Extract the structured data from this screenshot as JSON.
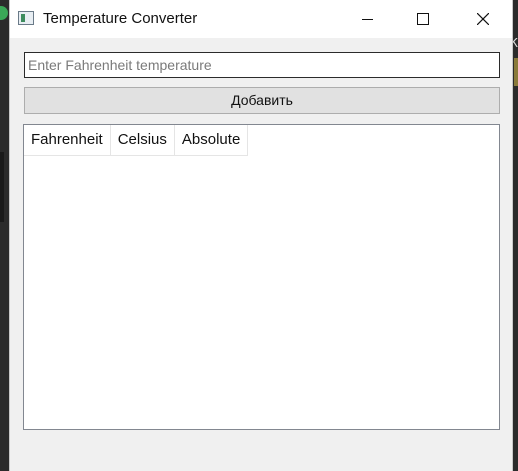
{
  "window": {
    "title": "Temperature Converter"
  },
  "form": {
    "input_placeholder": "Enter Fahrenheit temperature",
    "input_value": "",
    "add_button_label": "Добавить"
  },
  "table": {
    "columns": [
      "Fahrenheit",
      "Celsius",
      "Absolute"
    ],
    "rows": []
  },
  "background": {
    "right_edge_text": "К"
  },
  "colors": {
    "window_bg": "#f0f0f0",
    "titlebar_bg": "#ffffff",
    "button_bg": "#e1e1e1"
  }
}
